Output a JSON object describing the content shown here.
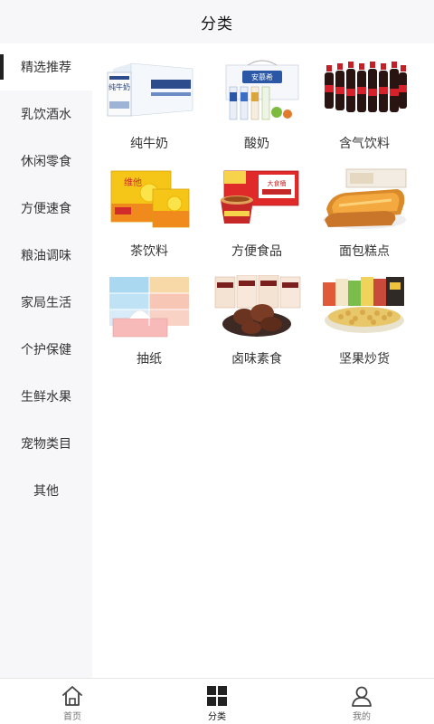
{
  "header": {
    "title": "分类"
  },
  "sidebar": {
    "items": [
      {
        "label": "精选推荐",
        "active": true
      },
      {
        "label": "乳饮酒水"
      },
      {
        "label": "休闲零食"
      },
      {
        "label": "方便速食"
      },
      {
        "label": "粮油调味"
      },
      {
        "label": "家局生活"
      },
      {
        "label": "个护保健"
      },
      {
        "label": "生鲜水果"
      },
      {
        "label": "宠物类目"
      },
      {
        "label": "其他"
      }
    ]
  },
  "products": [
    {
      "label": "纯牛奶",
      "image": "milk-box-image",
      "pack_text": "纯牛奶"
    },
    {
      "label": "酸奶",
      "image": "yogurt-gift-box-image",
      "pack_text": "安慕希"
    },
    {
      "label": "含气饮料",
      "image": "cola-bottles-image"
    },
    {
      "label": "茶饮料",
      "image": "lemon-tea-box-image",
      "pack_text": "维他"
    },
    {
      "label": "方便食品",
      "image": "instant-noodle-box-image",
      "pack_text": "大食桶"
    },
    {
      "label": "面包糕点",
      "image": "toast-bread-image"
    },
    {
      "label": "抽纸",
      "image": "tissue-packs-image"
    },
    {
      "label": "卤味素食",
      "image": "braised-snack-image"
    },
    {
      "label": "坚果炒货",
      "image": "nuts-snack-image"
    }
  ],
  "tabbar": {
    "tabs": [
      {
        "label": "首页",
        "icon": "home-icon"
      },
      {
        "label": "分类",
        "icon": "category-grid-icon",
        "active": true
      },
      {
        "label": "我的",
        "icon": "user-icon"
      }
    ]
  }
}
